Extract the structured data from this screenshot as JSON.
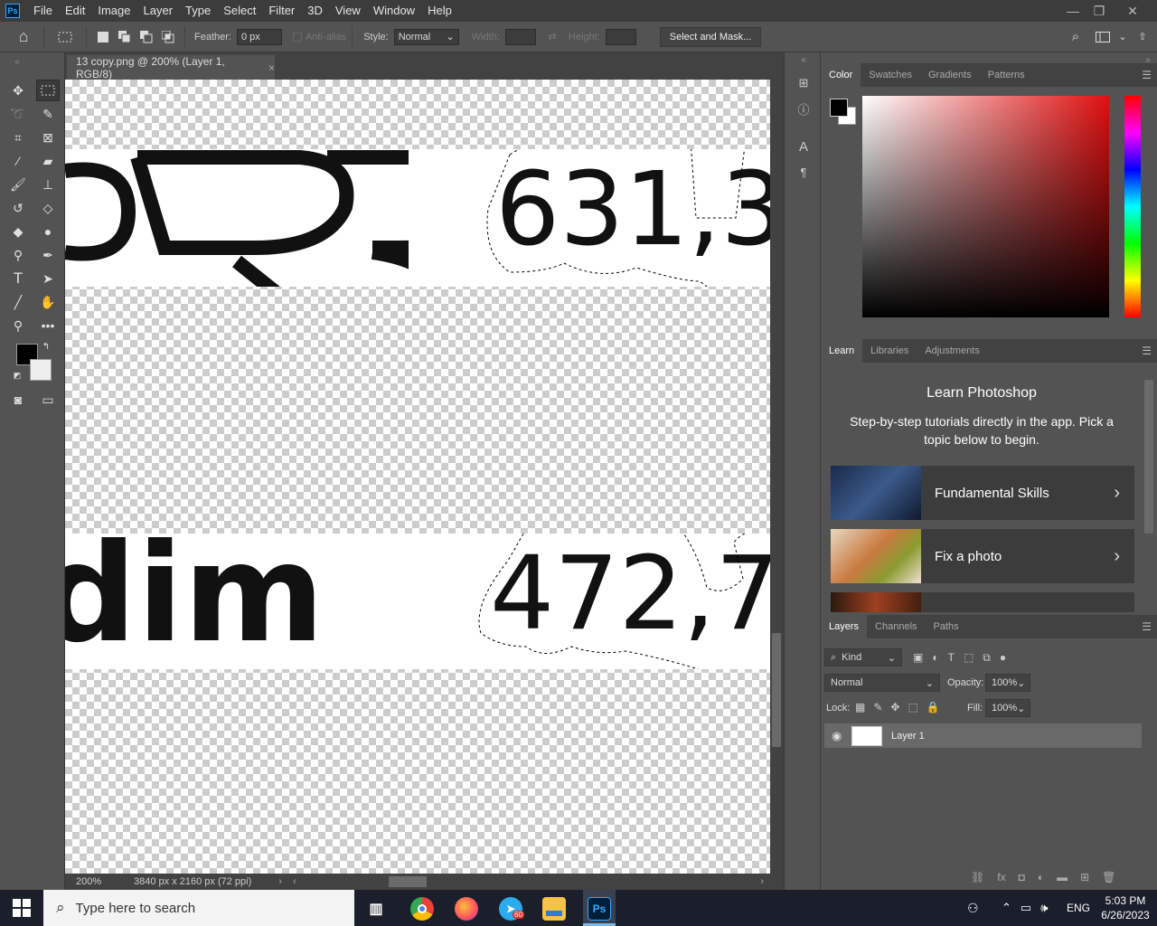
{
  "app": {
    "logo": "Ps"
  },
  "menu": [
    "File",
    "Edit",
    "Image",
    "Layer",
    "Type",
    "Select",
    "Filter",
    "3D",
    "View",
    "Window",
    "Help"
  ],
  "window_controls": {
    "minimize": "—",
    "maximize": "❐",
    "close": "✕"
  },
  "options": {
    "feather_label": "Feather:",
    "feather_value": "0 px",
    "antialias_label": "Anti-alias",
    "style_label": "Style:",
    "style_value": "Normal",
    "width_label": "Width:",
    "height_label": "Height:",
    "select_mask": "Select and Mask..."
  },
  "document": {
    "tab_title": "13 copy.png @ 200% (Layer 1, RGB/8)",
    "close": "×",
    "zoom": "200%",
    "dimensions": "3840 px x 2160 px (72 ppi)",
    "canvas_text_1": "631,3",
    "canvas_text_2": "472,7",
    "canvas_text_3": "dim"
  },
  "color_panel": {
    "tabs": [
      "Color",
      "Swatches",
      "Gradients",
      "Patterns"
    ],
    "foreground": "#000000",
    "background": "#ffffff"
  },
  "learn_panel": {
    "tabs": [
      "Learn",
      "Libraries",
      "Adjustments"
    ],
    "title": "Learn Photoshop",
    "description": "Step-by-step tutorials directly in the app. Pick a topic below to begin.",
    "cards": [
      {
        "label": "Fundamental Skills"
      },
      {
        "label": "Fix a photo"
      }
    ]
  },
  "layers_panel": {
    "tabs": [
      "Layers",
      "Channels",
      "Paths"
    ],
    "filter_kind": "Kind",
    "blend_mode": "Normal",
    "opacity_label": "Opacity:",
    "opacity_value": "100%",
    "lock_label": "Lock:",
    "fill_label": "Fill:",
    "fill_value": "100%",
    "layers": [
      {
        "name": "Layer 1"
      }
    ]
  },
  "taskbar": {
    "search_placeholder": "Type here to search",
    "telegram_badge": "60",
    "language": "ENG",
    "time": "5:03 PM",
    "date": "6/26/2023"
  }
}
